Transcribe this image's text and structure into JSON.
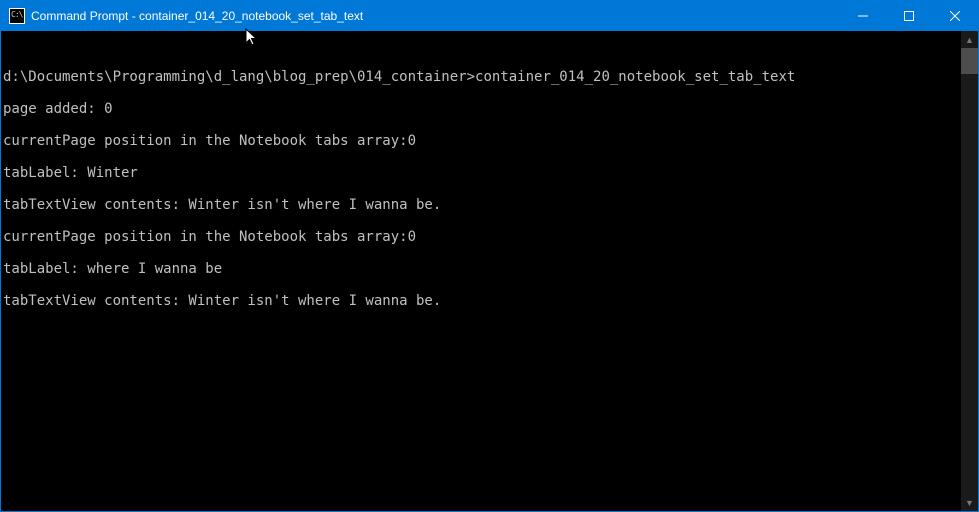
{
  "titlebar": {
    "icon_glyph": "C:\\",
    "title": "Command Prompt - container_014_20_notebook_set_tab_text"
  },
  "console": {
    "blank_top": "",
    "prompt_path": "d:\\Documents\\Programming\\d_lang\\blog_prep\\014_container>",
    "prompt_command": "container_014_20_notebook_set_tab_text",
    "lines": [
      "page added: 0",
      "currentPage position in the Notebook tabs array:0",
      "tabLabel: Winter",
      "tabTextView contents: Winter isn't where I wanna be.",
      "currentPage position in the Notebook tabs array:0",
      "tabLabel: where I wanna be",
      "tabTextView contents: Winter isn't where I wanna be."
    ]
  },
  "scrollbar": {
    "up_glyph": "▲",
    "down_glyph": "▼"
  }
}
